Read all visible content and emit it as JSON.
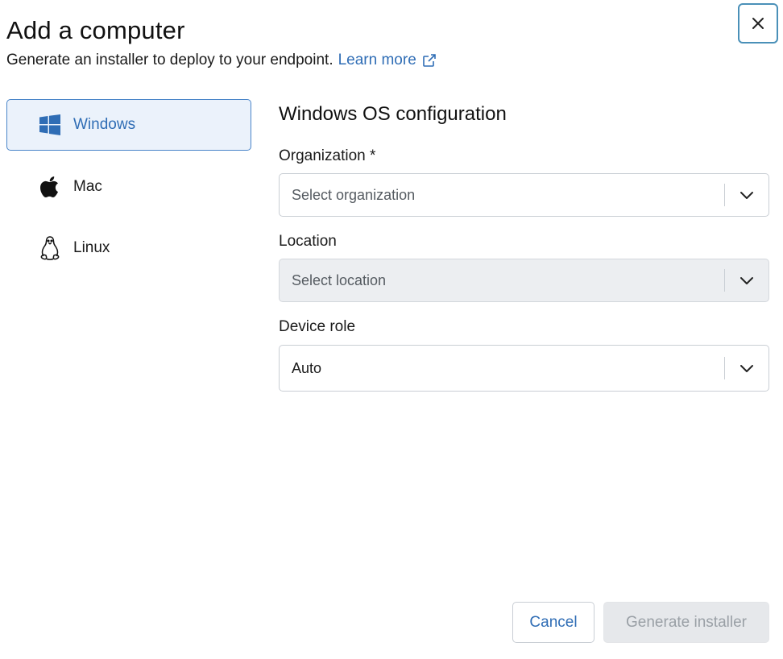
{
  "dialog": {
    "title": "Add a computer",
    "subtitle": "Generate an installer to deploy to your endpoint.",
    "learn_more": "Learn more",
    "close_icon": "close-icon"
  },
  "os_options": [
    {
      "label": "Windows",
      "icon": "windows-icon",
      "selected": true
    },
    {
      "label": "Mac",
      "icon": "apple-icon",
      "selected": false
    },
    {
      "label": "Linux",
      "icon": "linux-icon",
      "selected": false
    }
  ],
  "config": {
    "title": "Windows OS configuration",
    "organization": {
      "label": "Organization *",
      "placeholder": "Select organization",
      "value": ""
    },
    "location": {
      "label": "Location",
      "placeholder": "Select location",
      "value": "",
      "disabled": true
    },
    "device_role": {
      "label": "Device role",
      "value": "Auto"
    }
  },
  "footer": {
    "cancel_label": "Cancel",
    "generate_label": "Generate installer",
    "generate_enabled": false
  },
  "colors": {
    "accent": "#2f6db5",
    "selected_bg": "#ebf2fb",
    "focus_border": "#4a90b8",
    "disabled_bg": "#eceef1"
  }
}
